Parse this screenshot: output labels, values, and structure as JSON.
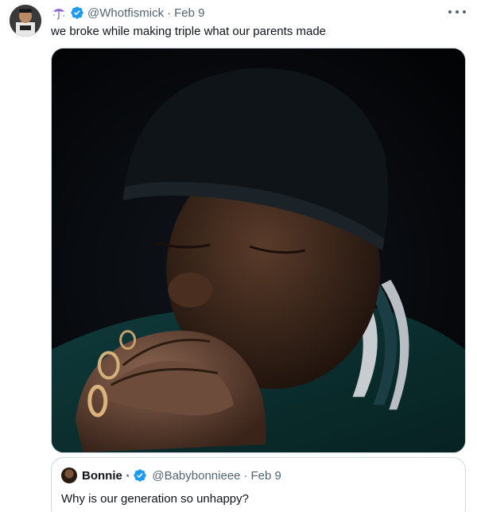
{
  "tweet": {
    "handle": "@Whotfismick",
    "separator": "·",
    "date": "Feb 9",
    "text": "we broke while making triple what our parents made",
    "header_emoji_icon": "umbrella-icon",
    "verified_icon": "verified-badge-icon",
    "more_icon": "more-horizontal-icon"
  },
  "quote": {
    "name": "Bonnie",
    "name_icon": "star-icon",
    "star_glyph": "⋆",
    "verified_icon": "verified-badge-icon",
    "handle": "@Babybonnieee",
    "separator": "·",
    "date": "Feb 9",
    "text": "Why is our generation so unhappy?"
  },
  "colors": {
    "text_primary": "#0f1419",
    "text_secondary": "#536471",
    "verified_blue": "#1d9bf0",
    "border": "#cfd9de"
  }
}
